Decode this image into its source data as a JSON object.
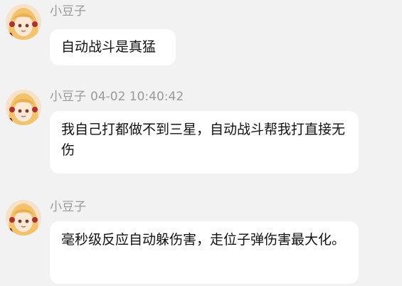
{
  "messages": [
    {
      "sender": "小豆子",
      "time": "",
      "text": "自动战斗是真猛"
    },
    {
      "sender": "小豆子",
      "time": "04-02 10:40:42",
      "text": "我自己打都做不到三星，自动战斗帮我打直接无伤"
    },
    {
      "sender": "小豆子",
      "time": "",
      "text": "毫秒级反应自动躲伤害，走位子弹伤害最大化。"
    }
  ],
  "avatar_icon": "anime-girl-avatar",
  "colors": {
    "background": "#f2f2f2",
    "bubble": "#ffffff",
    "name": "#9a9a9a",
    "text": "#111111"
  }
}
